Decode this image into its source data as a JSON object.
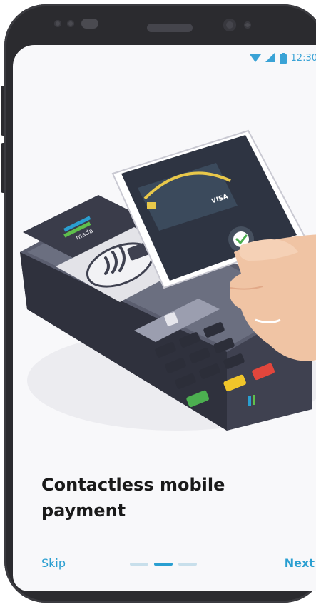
{
  "status_bar": {
    "time": "12:30",
    "icons": [
      "wifi-icon",
      "signal-icon",
      "battery-icon"
    ]
  },
  "illustration": {
    "terminal_brand": "mada",
    "card_brand": "VISA"
  },
  "onboarding": {
    "title_line1": "Contactless mobile",
    "title_line2": "payment",
    "skip_label": "Skip",
    "next_label": "Next",
    "page_count": 3,
    "active_page": 2
  },
  "colors": {
    "accent": "#2a9fd1",
    "frame": "#2b2b2f",
    "title": "#1a1a1a",
    "indicator_inactive": "#c8dfeb"
  }
}
